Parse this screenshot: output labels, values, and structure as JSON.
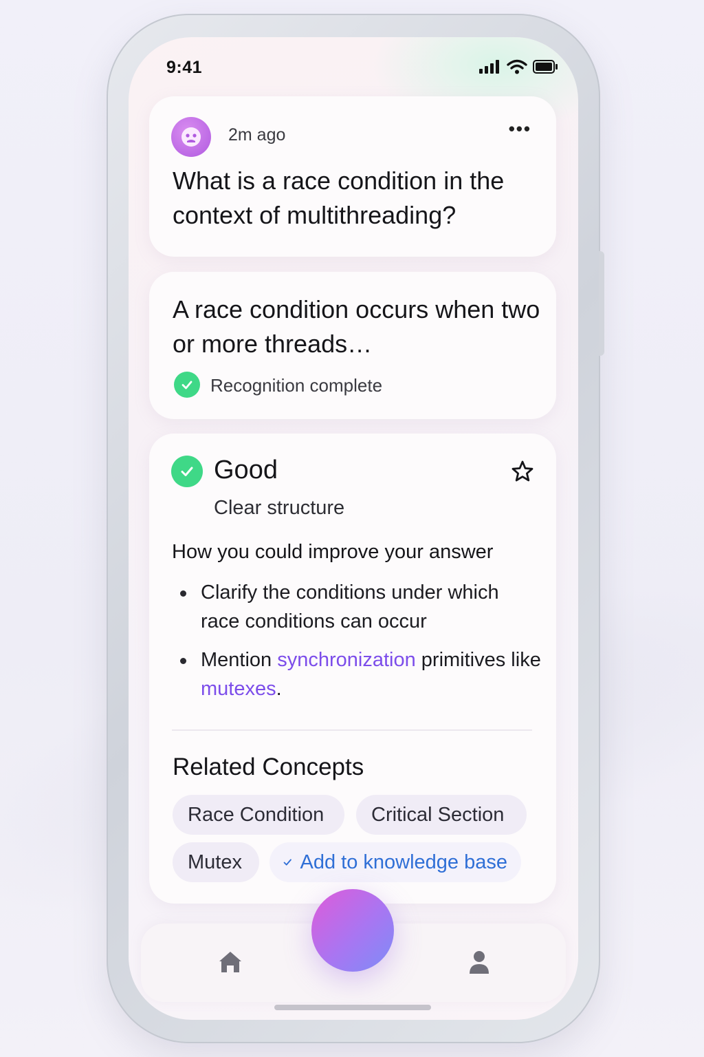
{
  "status_bar": {
    "time": "9:41"
  },
  "question_card": {
    "time_ago": "2m ago",
    "more_label": "•••",
    "question": "What is a race condition in the context of multithreading?"
  },
  "answer_card": {
    "answer": "A race condition occurs when two or more threads…",
    "status": "Recognition complete"
  },
  "feedback_card": {
    "rating": "Good",
    "summary": "Clear structure",
    "improve_title": "How you could improve your answer",
    "bullet_1": "Clarify the conditions under which race conditions can occur",
    "bullet_2_pre": "Mention ",
    "bullet_2_link_1": "synchronization",
    "bullet_2_mid": " primitives like ",
    "bullet_2_link_2": "mutexes",
    "bullet_2_post": ".",
    "related_title": "Related Concepts",
    "chips": [
      "Race Condition",
      "Critical Section",
      "Mutex"
    ],
    "add_label": "Add to knowledge base"
  },
  "colors": {
    "accent_green": "#3fd887",
    "link_purple": "#7c4dea",
    "add_blue": "#2f6fd6"
  },
  "icons": {
    "avatar": "avatar-face-icon",
    "status": [
      "cellular-signal-icon",
      "wifi-icon",
      "battery-icon"
    ],
    "rating": "check-circle-icon",
    "favorite": "star-outline-icon",
    "tabs": [
      "home-icon",
      "user-icon"
    ]
  }
}
